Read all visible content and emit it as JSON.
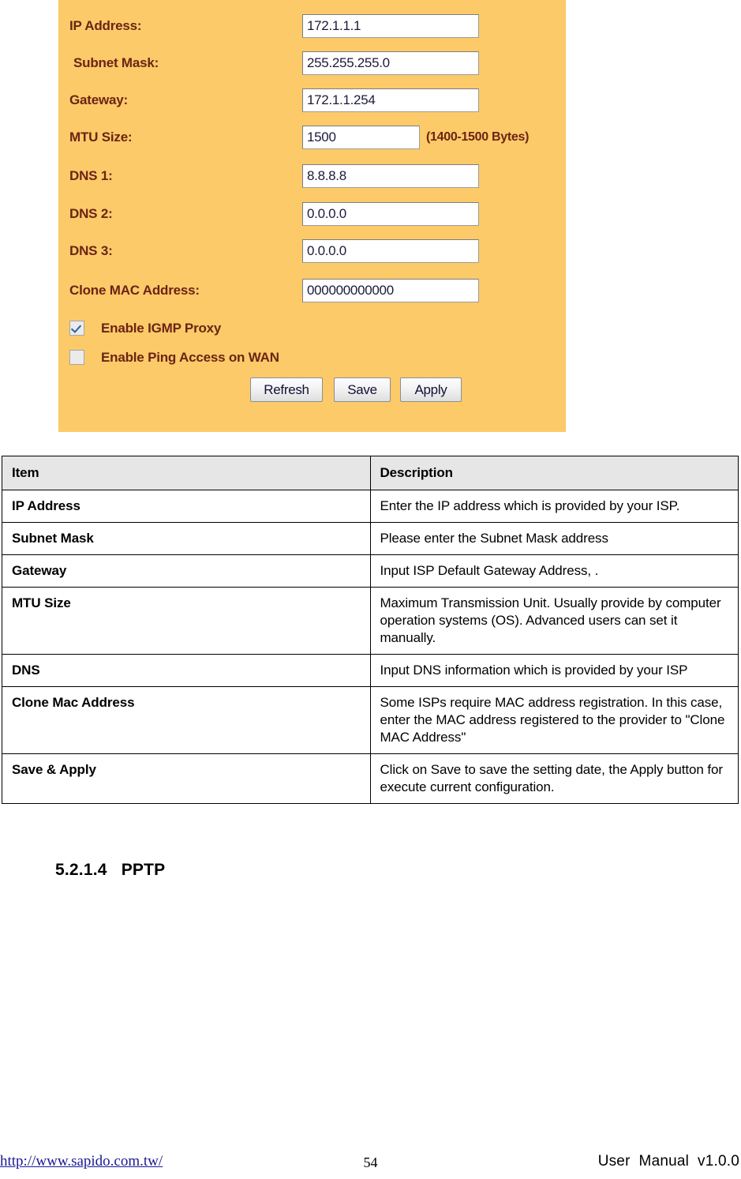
{
  "config_panel": {
    "accent_bg": "#fcca69",
    "label_color": "#6b2414",
    "fields": [
      {
        "label": "IP Address:",
        "value": "172.1.1.1",
        "hint": ""
      },
      {
        "label": "Subnet Mask:",
        "value": "255.255.255.0",
        "hint": ""
      },
      {
        "label": "Gateway:",
        "value": "172.1.1.254",
        "hint": ""
      },
      {
        "label": "MTU Size:",
        "value": "1500",
        "hint": "(1400-1500 Bytes)"
      },
      {
        "label": "DNS 1:",
        "value": "8.8.8.8",
        "hint": ""
      },
      {
        "label": "DNS 2:",
        "value": "0.0.0.0",
        "hint": ""
      },
      {
        "label": "DNS 3:",
        "value": "0.0.0.0",
        "hint": ""
      },
      {
        "label": "Clone MAC Address:",
        "value": "000000000000",
        "hint": ""
      }
    ],
    "checkboxes": [
      {
        "label": "Enable IGMP Proxy",
        "checked": true
      },
      {
        "label": "Enable Ping Access on WAN",
        "checked": false
      }
    ],
    "buttons": {
      "refresh": "Refresh",
      "save": "Save",
      "apply": "Apply"
    }
  },
  "table": {
    "headers": [
      "Item",
      "Description"
    ],
    "rows": [
      {
        "item": "IP Address",
        "description": "Enter the IP address which is provided by your ISP."
      },
      {
        "item": "Subnet Mask",
        "description": "Please enter the Subnet Mask address"
      },
      {
        "item": "Gateway",
        "description": "Input ISP Default Gateway Address, ."
      },
      {
        "item": "MTU Size",
        "description": "Maximum Transmission Unit. Usually provide by computer operation systems (OS). Advanced users can set it manually."
      },
      {
        "item": "DNS",
        "description": "Input DNS information which is provided by your ISP"
      },
      {
        "item": "Clone Mac Address",
        "description": "Some ISPs require MAC address registration. In this case, enter the MAC address registered to the provider to \"Clone MAC Address\""
      },
      {
        "item": "Save & Apply",
        "description": "Click on Save to save the setting date, the Apply button for execute current configuration."
      }
    ]
  },
  "section": {
    "heading": "5.2.1.4   PPTP"
  },
  "footer": {
    "url": "http://www.sapido.com.tw/",
    "page_number": "54",
    "manual": "User  Manual  v1.0.0",
    "link_color": "#1a1a96"
  }
}
